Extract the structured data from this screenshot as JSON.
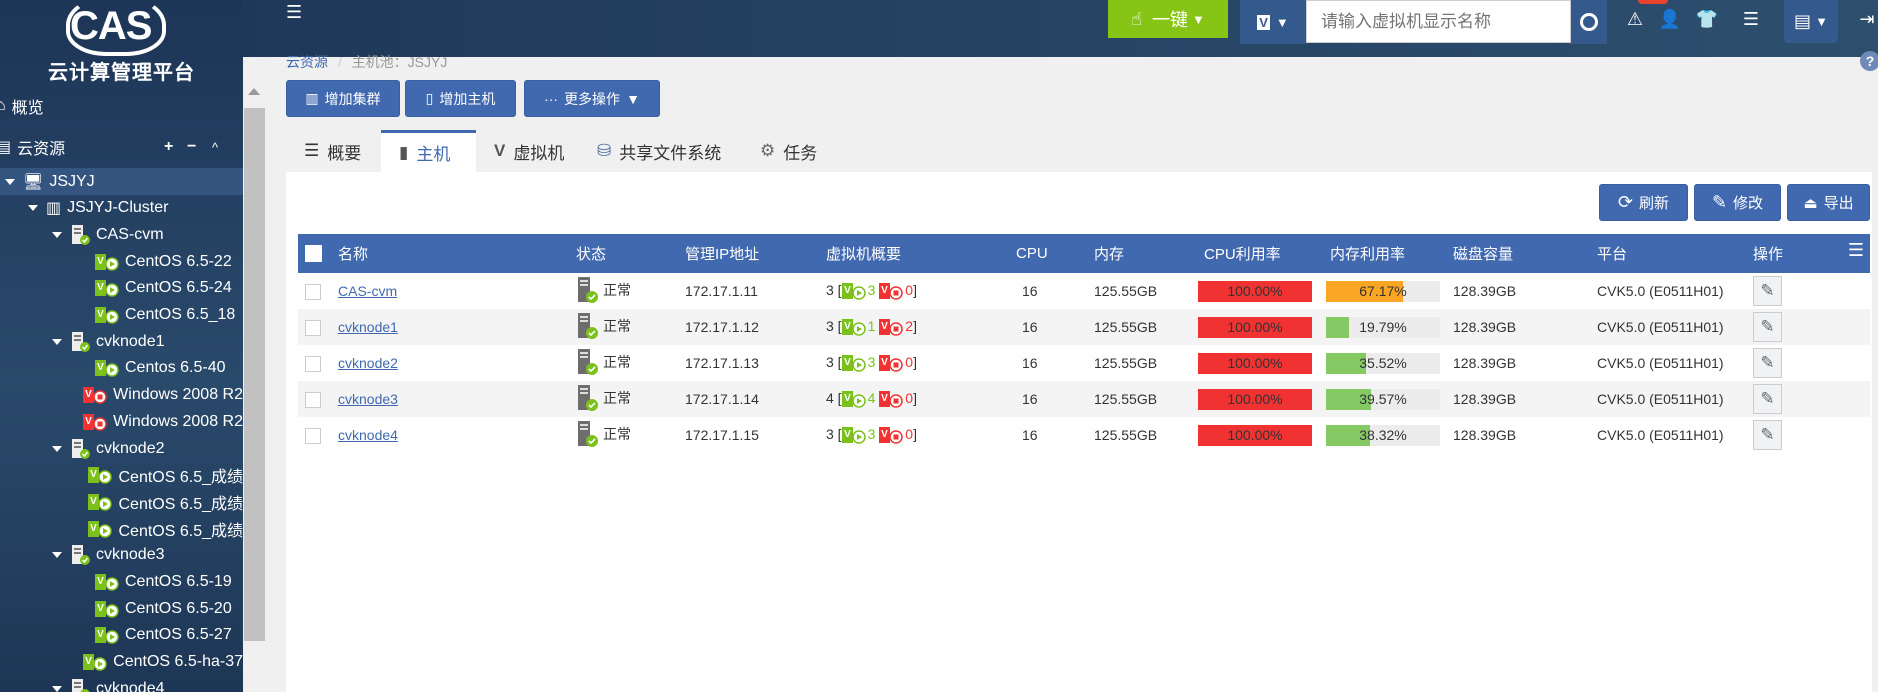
{
  "app": {
    "logo_text": "CAS",
    "subtitle": "云计算管理平台"
  },
  "header": {
    "onekey_label": "一键",
    "search_placeholder": "请输入虚拟机显示名称"
  },
  "sidebar": {
    "overview": "概览",
    "cloud_resources": "云资源",
    "controls": {
      "add": "+",
      "remove": "−",
      "collapse": "^"
    },
    "tree": [
      {
        "label": "JSJYJ",
        "level": 0,
        "type": "pool",
        "selected": true
      },
      {
        "label": "JSJYJ-Cluster",
        "level": 1,
        "type": "cluster"
      },
      {
        "label": "CAS-cvm",
        "level": 2,
        "type": "host"
      },
      {
        "label": "CentOS 6.5-22",
        "level": 3,
        "type": "vm-running"
      },
      {
        "label": "CentOS 6.5-24",
        "level": 3,
        "type": "vm-running"
      },
      {
        "label": "CentOS 6.5_18",
        "level": 3,
        "type": "vm-running"
      },
      {
        "label": "cvknode1",
        "level": 2,
        "type": "host"
      },
      {
        "label": "Centos 6.5-40",
        "level": 3,
        "type": "vm-running"
      },
      {
        "label": "Windows 2008 R2",
        "level": 3,
        "type": "vm-stopped"
      },
      {
        "label": "Windows 2008 R2",
        "level": 3,
        "type": "vm-stopped"
      },
      {
        "label": "cvknode2",
        "level": 2,
        "type": "host"
      },
      {
        "label": "CentOS 6.5_成绩",
        "level": 3,
        "type": "vm-running"
      },
      {
        "label": "CentOS 6.5_成绩",
        "level": 3,
        "type": "vm-running"
      },
      {
        "label": "CentOS 6.5_成绩",
        "level": 3,
        "type": "vm-running"
      },
      {
        "label": "cvknode3",
        "level": 2,
        "type": "host"
      },
      {
        "label": "CentOS 6.5-19",
        "level": 3,
        "type": "vm-running"
      },
      {
        "label": "CentOS 6.5-20",
        "level": 3,
        "type": "vm-running"
      },
      {
        "label": "CentOS 6.5-27",
        "level": 3,
        "type": "vm-running"
      },
      {
        "label": "CentOS 6.5-ha-37",
        "level": 3,
        "type": "vm-running"
      },
      {
        "label": "cvknode4",
        "level": 2,
        "type": "host"
      }
    ]
  },
  "breadcrumb": {
    "root": "云资源",
    "sep": "/",
    "current": "主机池：JSJYJ"
  },
  "toolbar": {
    "add_cluster": "增加集群",
    "add_host": "增加主机",
    "more": "更多操作"
  },
  "tabs": [
    {
      "label": "概要"
    },
    {
      "label": "主机",
      "active": true
    },
    {
      "label": "虚拟机"
    },
    {
      "label": "共享文件系统"
    },
    {
      "label": "任务"
    }
  ],
  "actions": {
    "refresh": "刷新",
    "modify": "修改",
    "export": "导出"
  },
  "table": {
    "columns": [
      "名称",
      "状态",
      "管理IP地址",
      "虚拟机概要",
      "CPU",
      "内存",
      "CPU利用率",
      "内存利用率",
      "磁盘容量",
      "平台",
      "操作"
    ],
    "rows": [
      {
        "name": "CAS-cvm",
        "status": "正常",
        "ip": "172.17.1.11",
        "vm_total": "3",
        "vm_running": "3",
        "vm_stopped": "0",
        "cpu": "16",
        "mem": "125.55GB",
        "cpu_usage": "100.00%",
        "cpu_pct": 100,
        "mem_usage": "67.17%",
        "mem_pct": 67.17,
        "disk": "128.39GB",
        "platform": "CVK5.0 (E0511H01)"
      },
      {
        "name": "cvknode1",
        "status": "正常",
        "ip": "172.17.1.12",
        "vm_total": "3",
        "vm_running": "1",
        "vm_stopped": "2",
        "cpu": "16",
        "mem": "125.55GB",
        "cpu_usage": "100.00%",
        "cpu_pct": 100,
        "mem_usage": "19.79%",
        "mem_pct": 19.79,
        "disk": "128.39GB",
        "platform": "CVK5.0 (E0511H01)"
      },
      {
        "name": "cvknode2",
        "status": "正常",
        "ip": "172.17.1.13",
        "vm_total": "3",
        "vm_running": "3",
        "vm_stopped": "0",
        "cpu": "16",
        "mem": "125.55GB",
        "cpu_usage": "100.00%",
        "cpu_pct": 100,
        "mem_usage": "35.52%",
        "mem_pct": 35.52,
        "disk": "128.39GB",
        "platform": "CVK5.0 (E0511H01)"
      },
      {
        "name": "cvknode3",
        "status": "正常",
        "ip": "172.17.1.14",
        "vm_total": "4",
        "vm_running": "4",
        "vm_stopped": "0",
        "cpu": "16",
        "mem": "125.55GB",
        "cpu_usage": "100.00%",
        "cpu_pct": 100,
        "mem_usage": "39.57%",
        "mem_pct": 39.57,
        "disk": "128.39GB",
        "platform": "CVK5.0 (E0511H01)"
      },
      {
        "name": "cvknode4",
        "status": "正常",
        "ip": "172.17.1.15",
        "vm_total": "3",
        "vm_running": "3",
        "vm_stopped": "0",
        "cpu": "16",
        "mem": "125.55GB",
        "cpu_usage": "100.00%",
        "cpu_pct": 100,
        "mem_usage": "38.32%",
        "mem_pct": 38.32,
        "disk": "128.39GB",
        "platform": "CVK5.0 (E0511H01)"
      }
    ]
  },
  "colors": {
    "primary": "#4169b0",
    "green": "#7cc11b",
    "red": "#f03232",
    "orange": "#f8a623",
    "mem_green": "#85c965",
    "onekey": "#86c516"
  }
}
